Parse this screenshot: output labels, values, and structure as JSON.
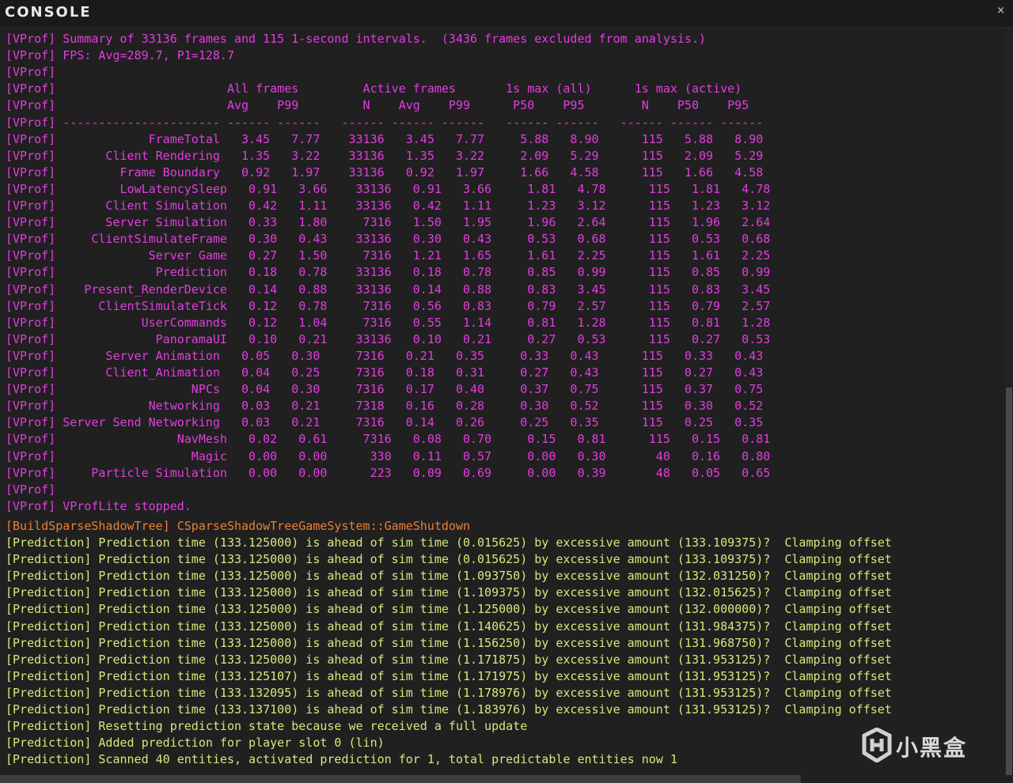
{
  "window": {
    "title": "CONSOLE",
    "close_icon": "×"
  },
  "vprof_lines": [
    "[VProf] Summary of 33136 frames and 115 1-second intervals.  (3436 frames excluded from analysis.)",
    "[VProf] FPS: Avg=289.7, P1=128.7",
    "[VProf]",
    "[VProf]                        All frames         Active frames       1s max (all)      1s max (active)",
    "[VProf]                        Avg    P99         N    Avg    P99      P50    P95        N    P50    P95",
    "[VProf] ---------------------- ------ ------   ------ ------ ------   ------ ------   ------ ------ ------",
    "[VProf]             FrameTotal   3.45   7.77    33136   3.45   7.77     5.88   8.90      115   5.88   8.90",
    "[VProf]       Client Rendering   1.35   3.22    33136   1.35   3.22     2.09   5.29      115   2.09   5.29",
    "[VProf]         Frame Boundary   0.92   1.97    33136   0.92   1.97     1.66   4.58      115   1.66   4.58",
    "[VProf]         LowLatencySleep   0.91   3.66    33136   0.91   3.66     1.81   4.78      115   1.81   4.78",
    "[VProf]       Client Simulation   0.42   1.11    33136   0.42   1.11     1.23   3.12      115   1.23   3.12",
    "[VProf]       Server Simulation   0.33   1.80     7316   1.50   1.95     1.96   2.64      115   1.96   2.64",
    "[VProf]     ClientSimulateFrame   0.30   0.43    33136   0.30   0.43     0.53   0.68      115   0.53   0.68",
    "[VProf]             Server Game   0.27   1.50     7316   1.21   1.65     1.61   2.25      115   1.61   2.25",
    "[VProf]              Prediction   0.18   0.78    33136   0.18   0.78     0.85   0.99      115   0.85   0.99",
    "[VProf]    Present_RenderDevice   0.14   0.88    33136   0.14   0.88     0.83   3.45      115   0.83   3.45",
    "[VProf]      ClientSimulateTick   0.12   0.78     7316   0.56   0.83     0.79   2.57      115   0.79   2.57",
    "[VProf]            UserCommands   0.12   1.04     7316   0.55   1.14     0.81   1.28      115   0.81   1.28",
    "[VProf]              PanoramaUI   0.10   0.21    33136   0.10   0.21     0.27   0.53      115   0.27   0.53",
    "[VProf]       Server Animation   0.05   0.30     7316   0.21   0.35     0.33   0.43      115   0.33   0.43",
    "[VProf]       Client_Animation   0.04   0.25     7316   0.18   0.31     0.27   0.43      115   0.27   0.43",
    "[VProf]                   NPCs   0.04   0.30     7316   0.17   0.40     0.37   0.75      115   0.37   0.75",
    "[VProf]             Networking   0.03   0.21     7318   0.16   0.28     0.30   0.52      115   0.30   0.52",
    "[VProf] Server Send Networking   0.03   0.21     7316   0.14   0.26     0.25   0.35      115   0.25   0.35",
    "[VProf]                 NavMesh   0.02   0.61     7316   0.08   0.70     0.15   0.81      115   0.15   0.81",
    "[VProf]                   Magic   0.00   0.00      330   0.11   0.57     0.00   0.30       40   0.16   0.80",
    "[VProf]     Particle Simulation   0.00   0.00      223   0.09   0.69     0.00   0.39       48   0.05   0.65",
    "[VProf]",
    "[VProf] VProfLite stopped."
  ],
  "shadow_line": "[BuildSparseShadowTree] CSparseShadowTreeGameSystem::GameShutdown",
  "prediction_lines": [
    "[Prediction] Prediction time (133.125000) is ahead of sim time (0.015625) by excessive amount (133.109375)?  Clamping offset",
    "[Prediction] Prediction time (133.125000) is ahead of sim time (0.015625) by excessive amount (133.109375)?  Clamping offset",
    "[Prediction] Prediction time (133.125000) is ahead of sim time (1.093750) by excessive amount (132.031250)?  Clamping offset",
    "[Prediction] Prediction time (133.125000) is ahead of sim time (1.109375) by excessive amount (132.015625)?  Clamping offset",
    "[Prediction] Prediction time (133.125000) is ahead of sim time (1.125000) by excessive amount (132.000000)?  Clamping offset",
    "[Prediction] Prediction time (133.125000) is ahead of sim time (1.140625) by excessive amount (131.984375)?  Clamping offset",
    "[Prediction] Prediction time (133.125000) is ahead of sim time (1.156250) by excessive amount (131.968750)?  Clamping offset",
    "[Prediction] Prediction time (133.125000) is ahead of sim time (1.171875) by excessive amount (131.953125)?  Clamping offset",
    "[Prediction] Prediction time (133.125107) is ahead of sim time (1.171975) by excessive amount (131.953125)?  Clamping offset",
    "[Prediction] Prediction time (133.132095) is ahead of sim time (1.178976) by excessive amount (131.953125)?  Clamping offset",
    "[Prediction] Prediction time (133.137100) is ahead of sim time (1.183976) by excessive amount (131.953125)?  Clamping offset",
    "[Prediction] Resetting prediction state because we received a full update",
    "[Prediction] Added prediction for player slot 0 (lin)",
    "[Prediction] Scanned 40 entities, activated prediction for 1, total predictable entities now 1"
  ],
  "watermark": {
    "text": "小黑盒",
    "icon": "heybox-logo-icon"
  },
  "colors": {
    "vprof": "#e23de0",
    "prediction": "#d6e87c",
    "shadow": "#ee7f31",
    "background": "#202020"
  }
}
